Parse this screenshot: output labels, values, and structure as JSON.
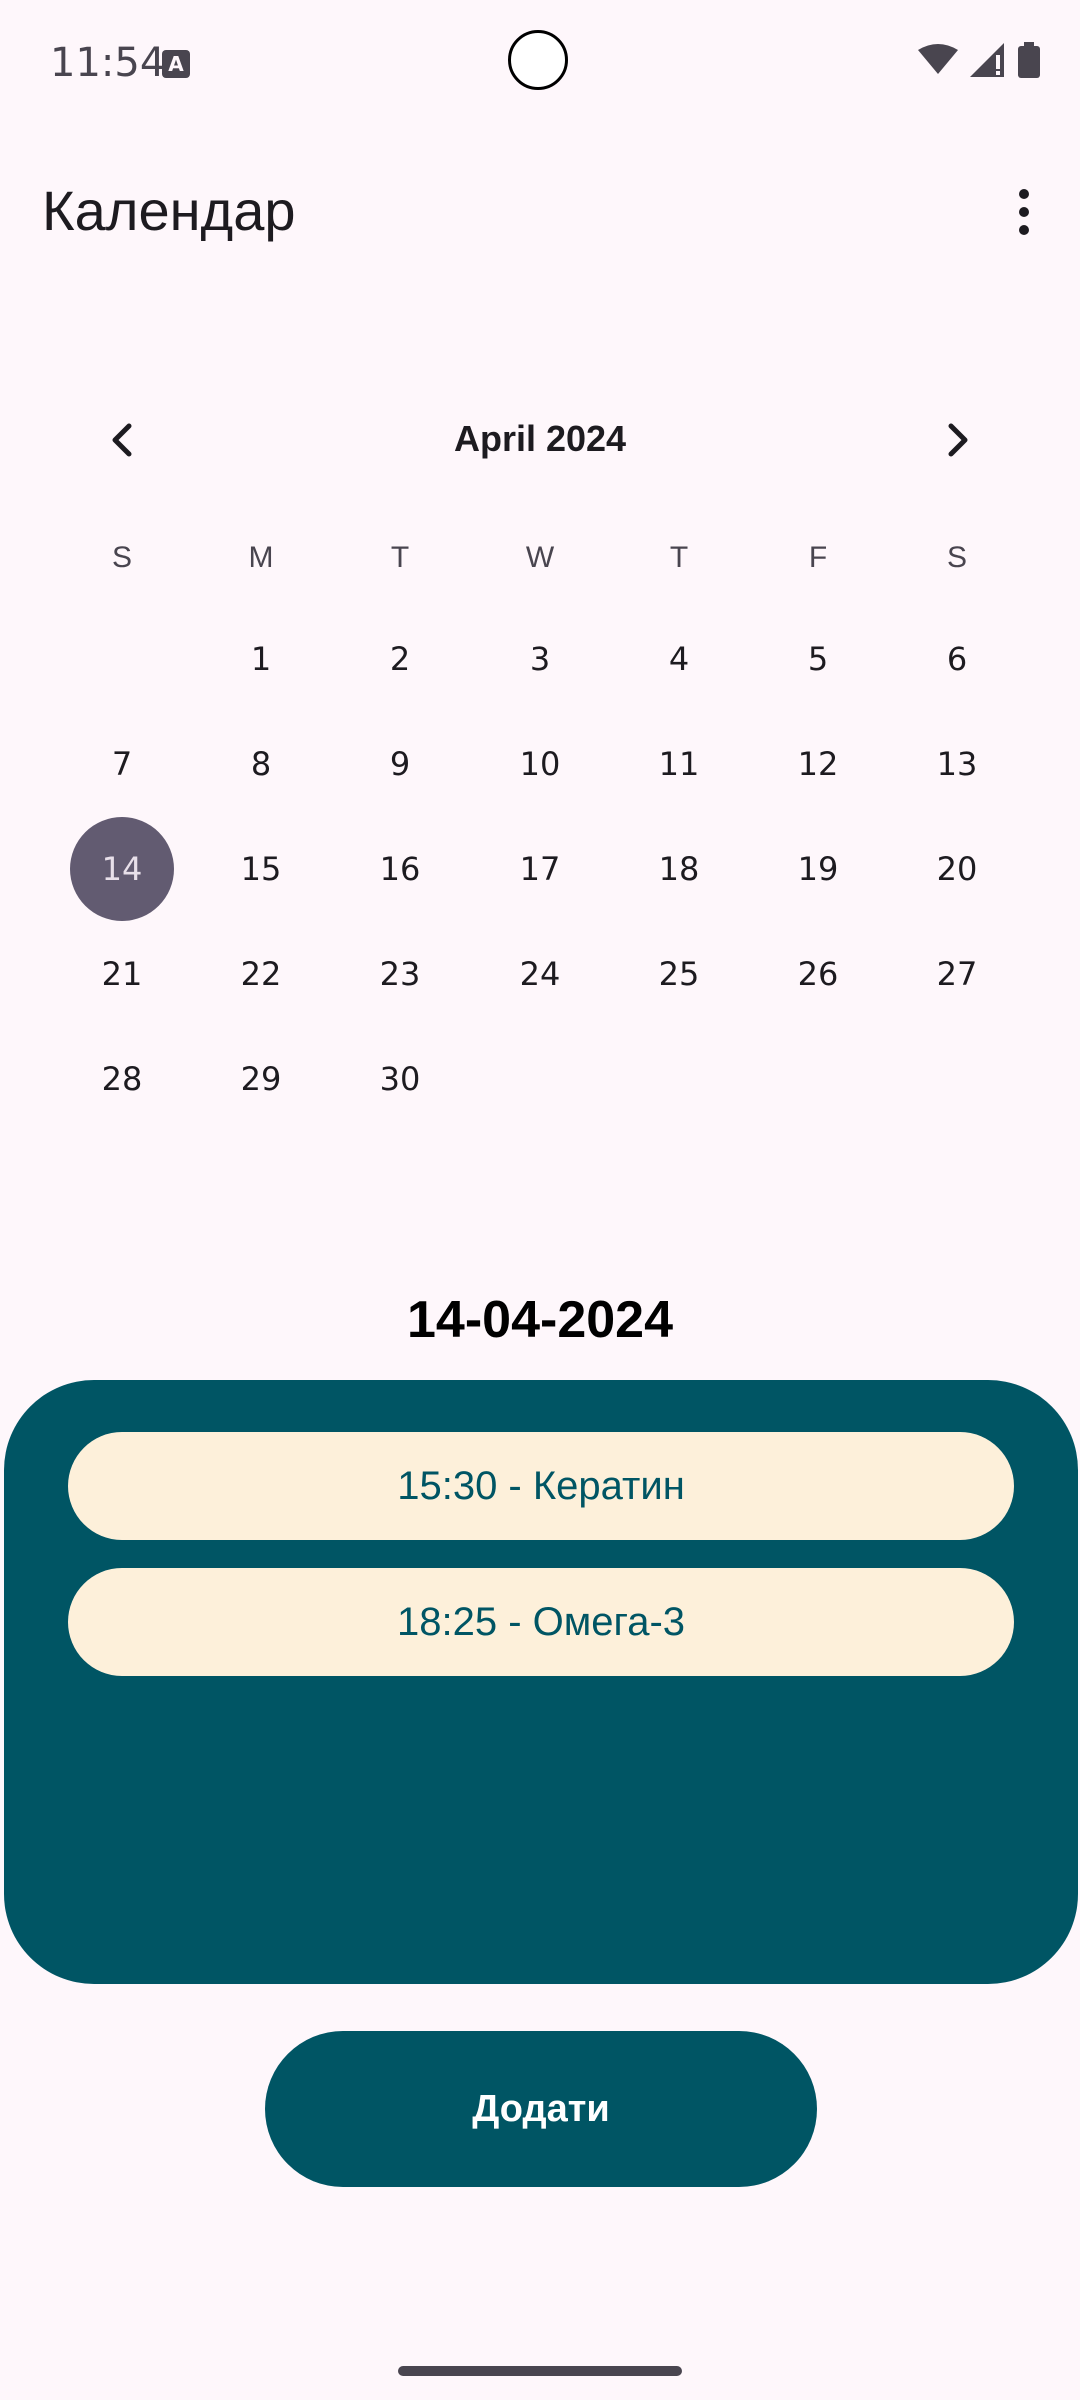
{
  "status_bar": {
    "time": "11:54",
    "app_icon": "A",
    "icons": [
      "wifi-icon",
      "signal-icon",
      "battery-icon"
    ]
  },
  "app_bar": {
    "title": "Календар",
    "menu_icon": "more-vert-icon"
  },
  "calendar": {
    "month_label": "April 2024",
    "prev_icon": "chevron-left-icon",
    "next_icon": "chevron-right-icon",
    "weekdays": [
      "S",
      "M",
      "T",
      "W",
      "T",
      "F",
      "S"
    ],
    "first_weekday_index": 1,
    "days_in_month": 30,
    "selected_day": 14,
    "selected_color": "#625B71"
  },
  "selected_date": "14-04-2024",
  "events": [
    {
      "label": "15:30 - Кератин"
    },
    {
      "label": "18:25 - Омега-3"
    }
  ],
  "add_button": {
    "label": "Додати"
  },
  "colors": {
    "primary": "#005564",
    "event_bg": "#FDF0DA",
    "background": "#FEF7FB"
  }
}
